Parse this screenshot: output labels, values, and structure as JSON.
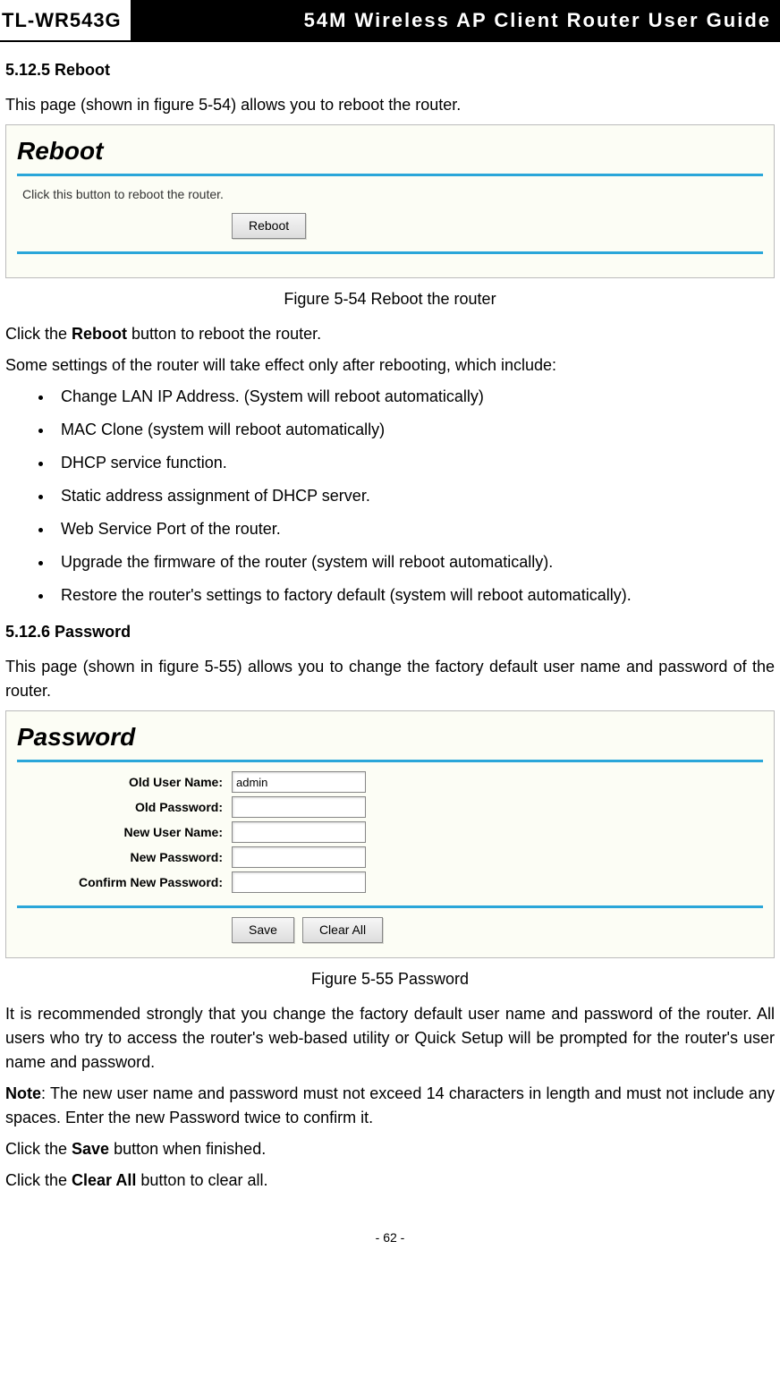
{
  "header": {
    "model": "TL-WR543G",
    "title": "54M Wireless AP Client Router User Guide"
  },
  "section_reboot": {
    "heading": "5.12.5 Reboot",
    "intro": "This page (shown in figure 5-54) allows you to reboot the router.",
    "panel": {
      "title": "Reboot",
      "instruction": "Click this button to reboot the router.",
      "button": "Reboot"
    },
    "caption": "Figure 5-54    Reboot the router",
    "after_caption_prefix": "Click the ",
    "reboot_bold": "Reboot",
    "after_caption_suffix": " button to reboot the router.",
    "list_intro": "Some settings of the router will take effect only after rebooting, which include:",
    "items": [
      "Change LAN IP Address. (System will reboot automatically)",
      "MAC Clone (system will reboot automatically)",
      "DHCP service function.",
      "Static address assignment of DHCP server.",
      "Web Service Port of the router.",
      "Upgrade the firmware of the router (system will reboot automatically).",
      "Restore the router's settings to factory default (system will reboot automatically)."
    ]
  },
  "section_password": {
    "heading": "5.12.6 Password",
    "intro": "This page (shown in figure 5-55) allows you to change the factory default user name and password of the router.",
    "panel": {
      "title": "Password",
      "fields": {
        "old_user_label": "Old User Name:",
        "old_user_value": "admin",
        "old_pass_label": "Old Password:",
        "old_pass_value": "",
        "new_user_label": "New User Name:",
        "new_user_value": "",
        "new_pass_label": "New Password:",
        "new_pass_value": "",
        "confirm_label": "Confirm New Password:",
        "confirm_value": ""
      },
      "buttons": {
        "save": "Save",
        "clear": "Clear All"
      }
    },
    "caption": "Figure 5-55    Password",
    "para1": "It is recommended strongly that you change the factory default user name and password of the router. All users who try to access the router's web-based utility or Quick Setup will be prompted for the router's user name and password.",
    "note_bold": "Note",
    "note_rest": ": The new user name and password must not exceed 14 characters in length and must not include any spaces. Enter the new Password twice to confirm it.",
    "save_prefix": "Click the ",
    "save_bold": "Save",
    "save_suffix": " button when finished.",
    "clear_prefix": "Click the ",
    "clear_bold": "Clear All",
    "clear_suffix": " button to clear all."
  },
  "page_number": "- 62 -"
}
